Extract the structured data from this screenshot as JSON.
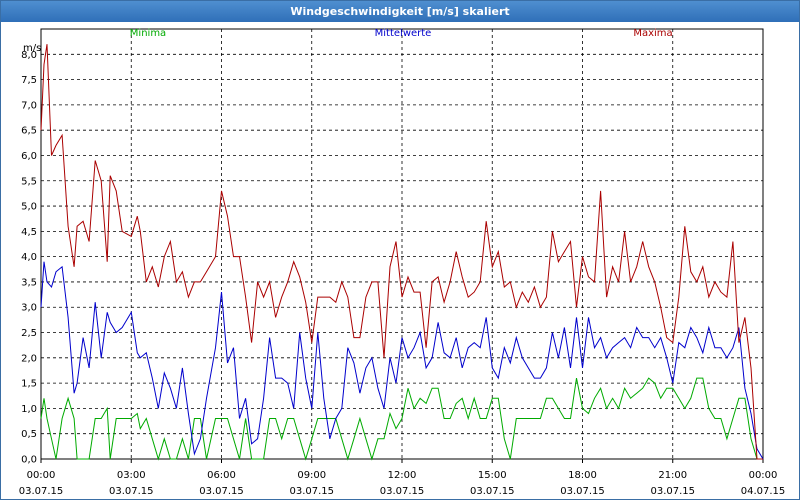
{
  "window": {
    "title": "Windgeschwindigkeit [m/s] skaliert"
  },
  "chart_data": {
    "type": "line",
    "title": "Windgeschwindigkeit [m/s] skaliert",
    "ylabel": "m/s",
    "ylim": [
      0,
      8.5
    ],
    "xlim_hours": [
      0,
      24
    ],
    "grid": true,
    "legend_position": "top",
    "y_ticks": [
      "0,0",
      "0,5",
      "1,0",
      "1,5",
      "2,0",
      "2,5",
      "3,0",
      "3,5",
      "4,0",
      "4,5",
      "5,0",
      "5,5",
      "6,0",
      "6,5",
      "7,0",
      "7,5",
      "8,0"
    ],
    "x_ticks": [
      {
        "time": "00:00",
        "date": "03.07.15"
      },
      {
        "time": "03:00",
        "date": "03.07.15"
      },
      {
        "time": "06:00",
        "date": "03.07.15"
      },
      {
        "time": "09:00",
        "date": "03.07.15"
      },
      {
        "time": "12:00",
        "date": "03.07.15"
      },
      {
        "time": "15:00",
        "date": "03.07.15"
      },
      {
        "time": "18:00",
        "date": "03.07.15"
      },
      {
        "time": "21:00",
        "date": "03.07.15"
      },
      {
        "time": "00:00",
        "date": "04.07.15"
      }
    ],
    "series": [
      {
        "name": "Minima",
        "color": "#00aa00",
        "x": [
          0,
          0.1,
          0.2,
          0.35,
          0.5,
          0.7,
          0.9,
          1.1,
          1.2,
          1.4,
          1.6,
          1.8,
          2,
          2.2,
          2.3,
          2.5,
          2.7,
          3,
          3.2,
          3.3,
          3.5,
          3.7,
          3.9,
          4.1,
          4.3,
          4.5,
          4.7,
          4.9,
          5.1,
          5.3,
          5.5,
          5.8,
          6,
          6.2,
          6.4,
          6.6,
          6.8,
          7,
          7.2,
          7.4,
          7.6,
          7.8,
          8,
          8.2,
          8.4,
          8.6,
          8.8,
          9,
          9.2,
          9.4,
          9.6,
          9.8,
          10,
          10.2,
          10.4,
          10.6,
          10.8,
          11,
          11.2,
          11.4,
          11.6,
          11.8,
          12,
          12.2,
          12.4,
          12.6,
          12.8,
          13,
          13.2,
          13.4,
          13.6,
          13.8,
          14,
          14.2,
          14.4,
          14.6,
          14.8,
          15,
          15.2,
          15.4,
          15.6,
          15.8,
          16,
          16.2,
          16.4,
          16.6,
          16.8,
          17,
          17.2,
          17.4,
          17.6,
          17.8,
          18,
          18.2,
          18.4,
          18.6,
          18.8,
          19,
          19.2,
          19.4,
          19.6,
          19.8,
          20,
          20.2,
          20.4,
          20.6,
          20.8,
          21,
          21.2,
          21.4,
          21.6,
          21.8,
          22,
          22.2,
          22.4,
          22.6,
          22.8,
          23,
          23.2,
          23.4,
          23.6,
          23.8,
          24
        ],
        "values": [
          0.8,
          1.2,
          0.8,
          0.4,
          0,
          0.8,
          1.2,
          0.8,
          0,
          0,
          0,
          0.8,
          0.8,
          1.0,
          0,
          0.8,
          0.8,
          0.8,
          0.9,
          0.6,
          0.8,
          0.4,
          0,
          0.4,
          0,
          0,
          0.4,
          0,
          0.8,
          0.8,
          0,
          0.8,
          0.8,
          0.8,
          0.4,
          0,
          0.8,
          0,
          0,
          0,
          0.8,
          0.8,
          0.4,
          0.8,
          0.8,
          0.4,
          0,
          0.4,
          0.8,
          0.8,
          0.8,
          0.8,
          0.4,
          0,
          0.4,
          0.8,
          0.4,
          0,
          0.4,
          0.4,
          0.9,
          0.6,
          0.8,
          1.4,
          1.0,
          1.2,
          1.1,
          1.4,
          1.4,
          0.8,
          0.8,
          1.1,
          1.2,
          0.8,
          1.2,
          0.8,
          0.8,
          1.2,
          1.2,
          0.4,
          0,
          0.8,
          0.8,
          0.8,
          0.8,
          0.8,
          1.2,
          1.2,
          1.0,
          0.8,
          0.8,
          1.6,
          1.0,
          0.9,
          1.2,
          1.4,
          1.0,
          1.2,
          1.0,
          1.4,
          1.2,
          1.3,
          1.4,
          1.6,
          1.5,
          1.2,
          1.4,
          1.4,
          1.2,
          1.0,
          1.2,
          1.6,
          1.6,
          1.0,
          0.8,
          0.8,
          0.4,
          0.8,
          1.2,
          1.2,
          0.4,
          0,
          0
        ],
        "show_name": true
      },
      {
        "name": "Mittelwerte",
        "color": "#0000cc",
        "x": [
          0,
          0.1,
          0.2,
          0.35,
          0.5,
          0.7,
          0.9,
          1.1,
          1.2,
          1.4,
          1.6,
          1.8,
          2,
          2.2,
          2.3,
          2.5,
          2.7,
          3,
          3.2,
          3.3,
          3.5,
          3.7,
          3.9,
          4.1,
          4.3,
          4.5,
          4.7,
          4.9,
          5.1,
          5.3,
          5.5,
          5.8,
          6,
          6.2,
          6.4,
          6.6,
          6.8,
          7,
          7.2,
          7.4,
          7.6,
          7.8,
          8,
          8.2,
          8.4,
          8.6,
          8.8,
          9,
          9.2,
          9.4,
          9.6,
          9.8,
          10,
          10.2,
          10.4,
          10.6,
          10.8,
          11,
          11.2,
          11.4,
          11.6,
          11.8,
          12,
          12.2,
          12.4,
          12.6,
          12.8,
          13,
          13.2,
          13.4,
          13.6,
          13.8,
          14,
          14.2,
          14.4,
          14.6,
          14.8,
          15,
          15.2,
          15.4,
          15.6,
          15.8,
          16,
          16.2,
          16.4,
          16.6,
          16.8,
          17,
          17.2,
          17.4,
          17.6,
          17.8,
          18,
          18.2,
          18.4,
          18.6,
          18.8,
          19,
          19.2,
          19.4,
          19.6,
          19.8,
          20,
          20.2,
          20.4,
          20.6,
          20.8,
          21,
          21.2,
          21.4,
          21.6,
          21.8,
          22,
          22.2,
          22.4,
          22.6,
          22.8,
          23,
          23.2,
          23.4,
          23.6,
          23.8,
          24
        ],
        "values": [
          3.0,
          3.9,
          3.5,
          3.4,
          3.7,
          3.8,
          2.8,
          1.3,
          1.5,
          2.4,
          1.8,
          3.1,
          2.0,
          2.9,
          2.7,
          2.5,
          2.6,
          2.9,
          2.1,
          2.0,
          2.1,
          1.6,
          1.0,
          1.7,
          1.4,
          1.0,
          1.8,
          0.9,
          0.1,
          0.4,
          1.2,
          2.2,
          3.3,
          1.9,
          2.2,
          0.8,
          1.2,
          0.3,
          0.4,
          1.2,
          2.4,
          1.6,
          1.6,
          1.5,
          1.0,
          2.5,
          1.6,
          1.0,
          2.5,
          1.2,
          0.4,
          0.8,
          1.0,
          2.2,
          1.9,
          1.3,
          1.8,
          2.0,
          1.4,
          1.0,
          2.0,
          1.5,
          2.4,
          2.0,
          2.2,
          2.5,
          1.8,
          2.0,
          2.7,
          2.1,
          2.0,
          2.4,
          1.8,
          2.2,
          2.3,
          2.2,
          2.8,
          1.8,
          1.6,
          2.2,
          1.9,
          2.4,
          2.0,
          1.8,
          1.6,
          1.6,
          1.8,
          2.5,
          2.0,
          2.6,
          1.8,
          2.8,
          1.8,
          2.8,
          2.2,
          2.4,
          2.0,
          2.2,
          2.3,
          2.4,
          2.2,
          2.6,
          2.4,
          2.4,
          2.2,
          2.4,
          2.0,
          1.5,
          2.3,
          2.2,
          2.6,
          2.4,
          2.1,
          2.6,
          2.2,
          2.2,
          2.0,
          2.2,
          2.6,
          1.4,
          0.9,
          0.2,
          0
        ],
        "show_name": true
      },
      {
        "name": "Maxima",
        "color": "#aa0000",
        "x": [
          0,
          0.1,
          0.2,
          0.35,
          0.5,
          0.7,
          0.9,
          1.1,
          1.2,
          1.4,
          1.6,
          1.8,
          2,
          2.2,
          2.3,
          2.5,
          2.7,
          3,
          3.2,
          3.3,
          3.5,
          3.7,
          3.9,
          4.1,
          4.3,
          4.5,
          4.7,
          4.9,
          5.1,
          5.3,
          5.5,
          5.8,
          6,
          6.2,
          6.4,
          6.6,
          6.8,
          7,
          7.2,
          7.4,
          7.6,
          7.8,
          8,
          8.2,
          8.4,
          8.6,
          8.8,
          9,
          9.2,
          9.4,
          9.6,
          9.8,
          10,
          10.2,
          10.4,
          10.6,
          10.8,
          11,
          11.2,
          11.4,
          11.6,
          11.8,
          12,
          12.2,
          12.4,
          12.6,
          12.8,
          13,
          13.2,
          13.4,
          13.6,
          13.8,
          14,
          14.2,
          14.4,
          14.6,
          14.8,
          15,
          15.2,
          15.4,
          15.6,
          15.8,
          16,
          16.2,
          16.4,
          16.6,
          16.8,
          17,
          17.2,
          17.4,
          17.6,
          17.8,
          18,
          18.2,
          18.4,
          18.6,
          18.8,
          19,
          19.2,
          19.4,
          19.6,
          19.8,
          20,
          20.2,
          20.4,
          20.6,
          20.8,
          21,
          21.2,
          21.4,
          21.6,
          21.8,
          22,
          22.2,
          22.4,
          22.6,
          22.8,
          23,
          23.2,
          23.4,
          23.6,
          23.8,
          24
        ],
        "values": [
          6.5,
          7.8,
          8.2,
          6.0,
          6.2,
          6.4,
          4.6,
          3.8,
          4.6,
          4.7,
          4.3,
          5.9,
          5.5,
          3.9,
          5.6,
          5.3,
          4.5,
          4.4,
          4.8,
          4.5,
          3.5,
          3.8,
          3.4,
          4.0,
          4.3,
          3.5,
          3.7,
          3.2,
          3.5,
          3.5,
          3.7,
          4.0,
          5.3,
          4.8,
          4.0,
          4.0,
          3.2,
          2.3,
          3.5,
          3.2,
          3.5,
          2.8,
          3.2,
          3.5,
          3.9,
          3.6,
          3.1,
          2.3,
          3.2,
          3.2,
          3.2,
          3.1,
          3.5,
          3.2,
          2.4,
          2.4,
          3.2,
          3.5,
          3.5,
          2.0,
          3.8,
          4.3,
          3.2,
          3.6,
          3.3,
          3.3,
          2.2,
          3.5,
          3.6,
          3.1,
          3.5,
          4.1,
          3.6,
          3.2,
          3.3,
          3.5,
          4.7,
          3.8,
          4.1,
          3.4,
          3.5,
          3.0,
          3.3,
          3.1,
          3.4,
          3.0,
          3.2,
          4.5,
          3.9,
          4.1,
          4.3,
          3.0,
          4.0,
          3.6,
          3.5,
          5.3,
          3.2,
          3.8,
          3.5,
          4.5,
          3.5,
          3.8,
          4.3,
          3.8,
          3.5,
          3.0,
          2.4,
          2.3,
          3.2,
          4.6,
          3.7,
          3.5,
          3.8,
          3.2,
          3.5,
          3.3,
          3.2,
          4.3,
          2.3,
          2.8,
          1.8,
          0,
          0
        ],
        "show_name": true
      }
    ]
  }
}
